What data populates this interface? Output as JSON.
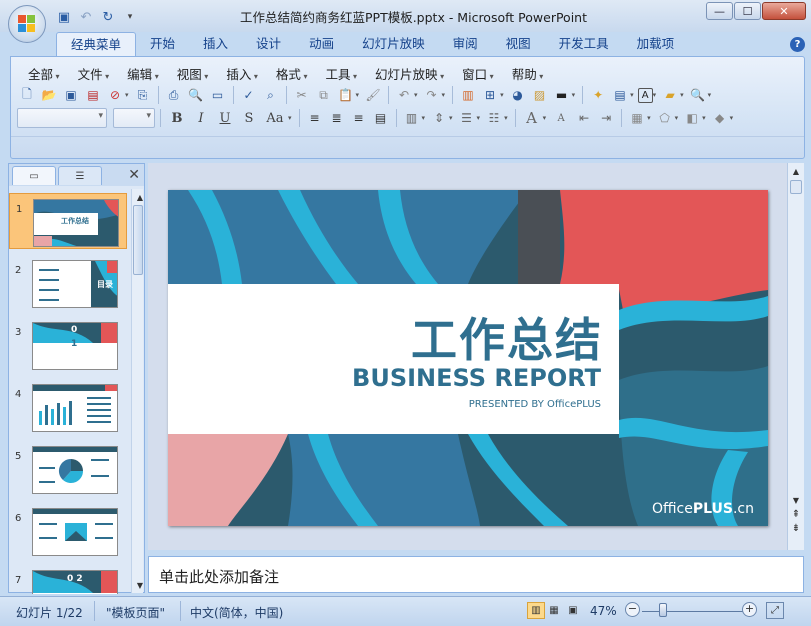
{
  "window": {
    "title": "工作总结简约商务红蓝PPT模板.pptx - Microsoft PowerPoint",
    "controls": {
      "minimize": "—",
      "maximize": "☐",
      "close": "✕"
    }
  },
  "quick_access": [
    "save-icon",
    "undo-icon",
    "redo-icon",
    "customize-icon"
  ],
  "ribbon": {
    "tabs": [
      "经典菜单",
      "开始",
      "插入",
      "设计",
      "动画",
      "幻灯片放映",
      "审阅",
      "视图",
      "开发工具",
      "加载项"
    ],
    "active_tab": "经典菜单",
    "menus": [
      "全部",
      "文件",
      "编辑",
      "视图",
      "插入",
      "格式",
      "工具",
      "幻灯片放映",
      "窗口",
      "帮助"
    ],
    "format_buttons": {
      "bold": "B",
      "italic": "I",
      "underline": "U",
      "shadow": "S",
      "change_case": "Aa",
      "font_grow": "A",
      "font_shrink": "A"
    }
  },
  "slides_pane": {
    "slide_numbers": [
      "1",
      "2",
      "3",
      "4",
      "5",
      "6",
      "7"
    ],
    "selected": "1",
    "thumb_text": {
      "s1": "工作总结",
      "s2": "目录",
      "s3_top": "0",
      "s3_bottom": "1",
      "s7": "0 2"
    }
  },
  "slide": {
    "title_cn": "工作总结",
    "title_en": "BUSINESS REPORT",
    "presented_by": "PRESENTED BY OfficePLUS",
    "brand_office": "Office",
    "brand_plus": "PLUS",
    "brand_suffix": ".cn",
    "colors": {
      "dark_teal": "#2c5a6d",
      "mid_blue": "#3577a1",
      "cyan": "#2ab2d8",
      "red": "#e35657",
      "pink": "#e8a5a7",
      "text_blue": "#2f6f8f"
    }
  },
  "notes": {
    "placeholder": "单击此处添加备注"
  },
  "status": {
    "slide_counter": "幻灯片 1/22",
    "theme": "\"模板页面\"",
    "language": "中文(简体，中国)",
    "zoom": "47%",
    "zoom_out": "−",
    "zoom_in": "+"
  }
}
